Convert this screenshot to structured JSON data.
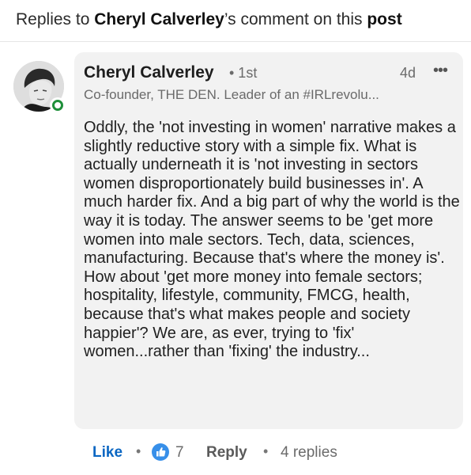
{
  "header": {
    "prefix": "Replies to ",
    "author": "Cheryl Calverley",
    "middle": "’s comment on this ",
    "target": "post"
  },
  "comment": {
    "author_name": "Cheryl Calverley",
    "degree": "• 1st",
    "time": "4d",
    "more_icon": "•••",
    "headline": "Co-founder, THE DEN. Leader of an #IRLrevolu...",
    "text": "Oddly, the 'not investing in women' narrative makes a slightly reductive story with a simple fix. What is actually underneath it is 'not investing in sectors women disproportionately build businesses in'. A much harder fix. And a big part of why the world is the way it is today. The answer seems to be 'get more women into male sectors. Tech, data, sciences, manufacturing. Because that's where the money is'. How about 'get more money into female sectors; hospitality, lifestyle, community, FMCG, health, because that's what makes people and society happier'? We are, as ever, trying to 'fix' women...rather than 'fixing' the industry..."
  },
  "actions": {
    "like_label": "Like",
    "separator": "•",
    "reaction_count": "7",
    "reply_label": "Reply",
    "replies_label": "4 replies"
  },
  "colors": {
    "accent": "#0a66c2",
    "reaction_bg": "#378fe9",
    "presence": "#1f8f3a",
    "bubble_bg": "#f2f2f2"
  }
}
